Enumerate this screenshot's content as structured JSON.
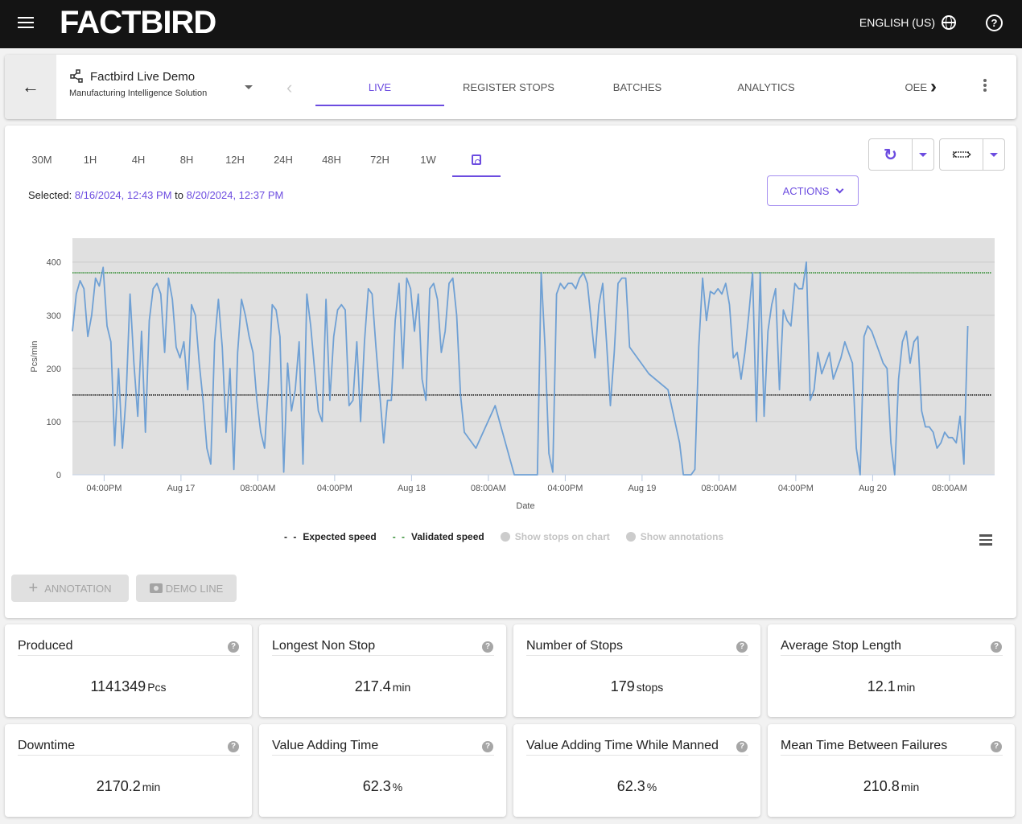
{
  "topbar": {
    "logo": "FACTBIRD",
    "language": "ENGLISH (US)"
  },
  "nav": {
    "line_name": "Factbird Live Demo",
    "line_subtitle": "Manufacturing Intelligence Solution",
    "tabs": [
      {
        "label": "LIVE",
        "active": true
      },
      {
        "label": "REGISTER STOPS",
        "active": false
      },
      {
        "label": "BATCHES",
        "active": false
      },
      {
        "label": "ANALYTICS",
        "active": false
      },
      {
        "label": "OEE",
        "active": false
      }
    ]
  },
  "controls": {
    "ranges": [
      "30M",
      "1H",
      "4H",
      "8H",
      "12H",
      "24H",
      "48H",
      "72H",
      "1W"
    ],
    "custom_range_active": true,
    "selected_label": "Selected:",
    "selected_from": "8/16/2024, 12:43 PM",
    "selected_to_word": "to",
    "selected_to": "8/20/2024, 12:37 PM",
    "actions_label": "ACTIONS",
    "accent_color": "#6c4ce0"
  },
  "chart_data": {
    "type": "line",
    "xlabel": "Date",
    "ylabel": "Pcs/min",
    "ylim": [
      0,
      445
    ],
    "yticks": [
      0,
      100,
      200,
      300,
      400
    ],
    "x_range_hours": [
      0,
      96
    ],
    "xticks": [
      {
        "hour": 3.3,
        "label": "04:00PM"
      },
      {
        "hour": 11.3,
        "label": "Aug 17"
      },
      {
        "hour": 19.3,
        "label": "08:00AM"
      },
      {
        "hour": 27.3,
        "label": "04:00PM"
      },
      {
        "hour": 35.3,
        "label": "Aug 18"
      },
      {
        "hour": 43.3,
        "label": "08:00AM"
      },
      {
        "hour": 51.3,
        "label": "04:00PM"
      },
      {
        "hour": 59.3,
        "label": "Aug 19"
      },
      {
        "hour": 67.3,
        "label": "08:00AM"
      },
      {
        "hour": 75.3,
        "label": "04:00PM"
      },
      {
        "hour": 83.3,
        "label": "Aug 20"
      },
      {
        "hour": 91.3,
        "label": "08:00AM"
      }
    ],
    "grid": true,
    "reference_lines": [
      {
        "name": "Expected speed",
        "value": 150,
        "color": "#111111"
      },
      {
        "name": "Validated speed",
        "value": 380,
        "color": "#2e8b2e"
      }
    ],
    "series": [
      {
        "name": "Speed",
        "color": "#6fa0d4",
        "x": [
          0,
          0.4,
          0.8,
          1.2,
          1.6,
          2.0,
          2.4,
          2.8,
          3.2,
          3.6,
          4.0,
          4.4,
          4.8,
          5.2,
          5.6,
          6.0,
          6.4,
          6.8,
          7.2,
          7.6,
          8.0,
          8.4,
          8.8,
          9.2,
          9.6,
          10.0,
          10.4,
          10.8,
          11.2,
          11.6,
          12.0,
          12.4,
          12.8,
          13.2,
          13.6,
          14.0,
          14.4,
          14.8,
          15.2,
          15.6,
          16.0,
          16.4,
          16.8,
          17.2,
          17.6,
          18.0,
          18.4,
          18.8,
          19.2,
          19.6,
          20.0,
          20.4,
          20.8,
          21.2,
          21.6,
          22.0,
          22.4,
          22.8,
          23.2,
          23.6,
          24.0,
          24.4,
          24.8,
          25.2,
          25.6,
          26.0,
          26.4,
          26.8,
          27.2,
          27.6,
          28.0,
          28.4,
          28.8,
          29.2,
          29.6,
          30.0,
          30.4,
          30.8,
          31.2,
          31.6,
          32.0,
          32.4,
          32.8,
          33.2,
          33.6,
          34.0,
          34.4,
          34.8,
          35.2,
          35.6,
          36.0,
          36.4,
          36.8,
          37.2,
          37.6,
          38.0,
          38.4,
          38.8,
          39.2,
          39.6,
          40.0,
          40.4,
          40.8,
          42.0,
          44.0,
          46.0,
          47.6,
          48.0,
          48.4,
          48.8,
          49.2,
          49.6,
          50.0,
          50.4,
          50.8,
          51.2,
          51.6,
          52.0,
          52.4,
          52.8,
          53.2,
          53.6,
          54.0,
          54.4,
          54.8,
          55.2,
          55.6,
          56.0,
          56.4,
          56.8,
          57.2,
          57.6,
          58.0,
          60.0,
          62.0,
          63.2,
          63.6,
          64.0,
          64.4,
          64.8,
          65.2,
          65.6,
          66.0,
          66.4,
          66.8,
          67.2,
          67.6,
          68.0,
          68.4,
          68.8,
          69.2,
          69.6,
          70.0,
          70.4,
          70.8,
          71.2,
          71.6,
          72.0,
          72.4,
          72.8,
          73.2,
          73.6,
          74.0,
          74.4,
          74.8,
          75.2,
          75.6,
          76.0,
          76.4,
          76.8,
          77.2,
          77.6,
          78.0,
          78.4,
          78.8,
          79.2,
          79.6,
          80.0,
          80.4,
          80.8,
          81.2,
          81.6,
          82.0,
          82.4,
          82.8,
          83.2,
          83.6,
          84.0,
          84.4,
          84.8,
          85.2,
          85.6,
          86.0,
          86.4,
          86.8,
          87.2,
          87.6,
          88.0,
          88.4,
          88.8,
          89.2,
          89.6,
          90.0,
          90.4,
          90.8,
          91.2,
          91.6,
          92.0,
          92.4,
          92.8,
          93.2,
          93.6,
          94.0,
          94.4,
          94.8,
          95.2,
          95.6,
          96.0
        ],
        "y": [
          270,
          340,
          365,
          350,
          260,
          300,
          370,
          355,
          390,
          280,
          250,
          55,
          200,
          50,
          150,
          340,
          210,
          110,
          270,
          80,
          290,
          350,
          360,
          340,
          230,
          370,
          330,
          240,
          220,
          250,
          160,
          320,
          300,
          210,
          140,
          50,
          20,
          250,
          330,
          240,
          80,
          200,
          10,
          230,
          330,
          300,
          260,
          230,
          140,
          80,
          50,
          170,
          320,
          310,
          260,
          5,
          210,
          120,
          160,
          250,
          20,
          340,
          280,
          200,
          120,
          100,
          330,
          140,
          260,
          310,
          320,
          310,
          130,
          140,
          250,
          100,
          250,
          350,
          340,
          240,
          150,
          60,
          140,
          140,
          290,
          360,
          200,
          370,
          350,
          270,
          340,
          180,
          140,
          350,
          360,
          330,
          230,
          270,
          360,
          370,
          300,
          150,
          80,
          50,
          130,
          0,
          0,
          0,
          0,
          380,
          240,
          40,
          5,
          340,
          360,
          350,
          360,
          360,
          350,
          370,
          380,
          360,
          290,
          220,
          320,
          360,
          250,
          130,
          230,
          360,
          370,
          370,
          240,
          190,
          160,
          60,
          0,
          0,
          0,
          10,
          240,
          370,
          290,
          345,
          340,
          350,
          340,
          360,
          320,
          220,
          230,
          180,
          230,
          300,
          380,
          100,
          380,
          110,
          270,
          320,
          350,
          160,
          310,
          290,
          280,
          360,
          350,
          350,
          400,
          140,
          160,
          230,
          190,
          210,
          230,
          180,
          200,
          220,
          250,
          230,
          210,
          50,
          0,
          260,
          280,
          270,
          250,
          230,
          210,
          200,
          60,
          0,
          180,
          250,
          270,
          210,
          250,
          260,
          120,
          90,
          90,
          80,
          50,
          60,
          80,
          70,
          70,
          60,
          110,
          20,
          280
        ]
      }
    ]
  },
  "legend": {
    "expected": "Expected speed",
    "validated": "Validated speed",
    "show_stops": "Show stops on chart",
    "show_annotations": "Show annotations"
  },
  "buttons": {
    "annotation": "ANNOTATION",
    "demo_line": "DEMO LINE"
  },
  "kpis": [
    {
      "title": "Produced",
      "value": "1141349",
      "unit": "Pcs"
    },
    {
      "title": "Longest Non Stop",
      "value": "217.4",
      "unit": "min"
    },
    {
      "title": "Number of Stops",
      "value": "179",
      "unit": "stops"
    },
    {
      "title": "Average Stop Length",
      "value": "12.1",
      "unit": "min"
    },
    {
      "title": "Downtime",
      "value": "2170.2",
      "unit": "min"
    },
    {
      "title": "Value Adding Time",
      "value": "62.3",
      "unit": "%"
    },
    {
      "title": "Value Adding Time While Manned",
      "value": "62.3",
      "unit": "%"
    },
    {
      "title": "Mean Time Between Failures",
      "value": "210.8",
      "unit": "min"
    }
  ]
}
